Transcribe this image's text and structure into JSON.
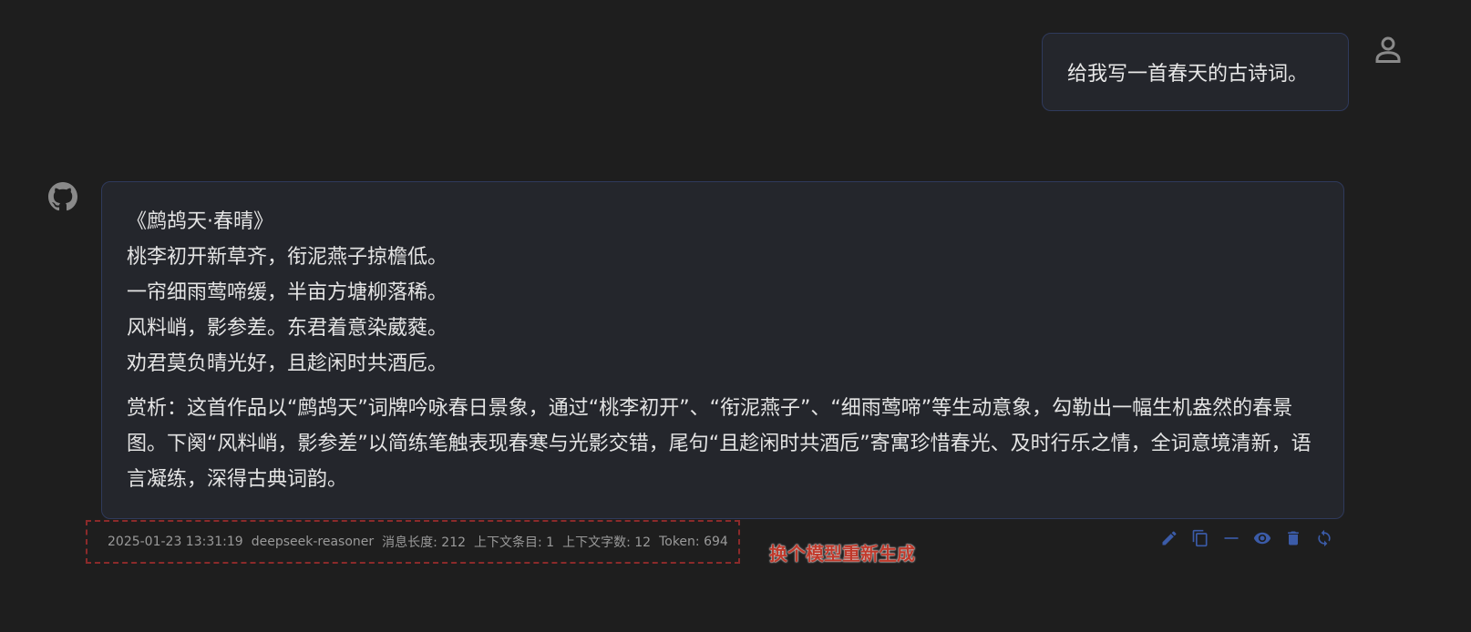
{
  "user_message": {
    "text": "给我写一首春天的古诗词。",
    "avatar_icon": "user-icon"
  },
  "assistant_message": {
    "avatar_icon": "github-icon",
    "poem_lines": [
      "《鹧鸪天·春晴》",
      "桃李初开新草齐，衔泥燕子掠檐低。",
      "一帘细雨莺啼缓，半亩方塘柳落稀。",
      "风料峭，影参差。东君着意染葳蕤。",
      "劝君莫负晴光好，且趁闲时共酒卮。"
    ],
    "analysis": "赏析：这首作品以“鹧鸪天”词牌吟咏春日景象，通过“桃李初开”、“衔泥燕子”、“细雨莺啼”等生动意象，勾勒出一幅生机盎然的春景图。下阕“风料峭，影参差”以简练笔触表现春寒与光影交错，尾句“且趁闲时共酒卮”寄寓珍惜春光、及时行乐之情，全词意境清新，语言凝练，深得古典词韵。"
  },
  "meta": {
    "timestamp": "2025-01-23 13:31:19",
    "model": "deepseek-reasoner",
    "message_length": "消息长度: 212",
    "context_items": "上下文条目: 1",
    "context_chars": "上下文字数: 12",
    "tokens": "Token: 694"
  },
  "annotation": "换个模型重新生成",
  "actions": [
    {
      "name": "edit",
      "icon": "pencil-icon"
    },
    {
      "name": "copy",
      "icon": "copy-icon"
    },
    {
      "name": "collapse",
      "icon": "minus-icon"
    },
    {
      "name": "preview",
      "icon": "eye-icon"
    },
    {
      "name": "delete",
      "icon": "trash-icon"
    },
    {
      "name": "regenerate",
      "icon": "refresh-icon"
    }
  ],
  "colors": {
    "background": "#1e1e1e",
    "bubble": "#24262c",
    "bubble_border": "#2f3a5c",
    "action_icon": "#3b5ba8",
    "annotation": "#c0392b"
  }
}
